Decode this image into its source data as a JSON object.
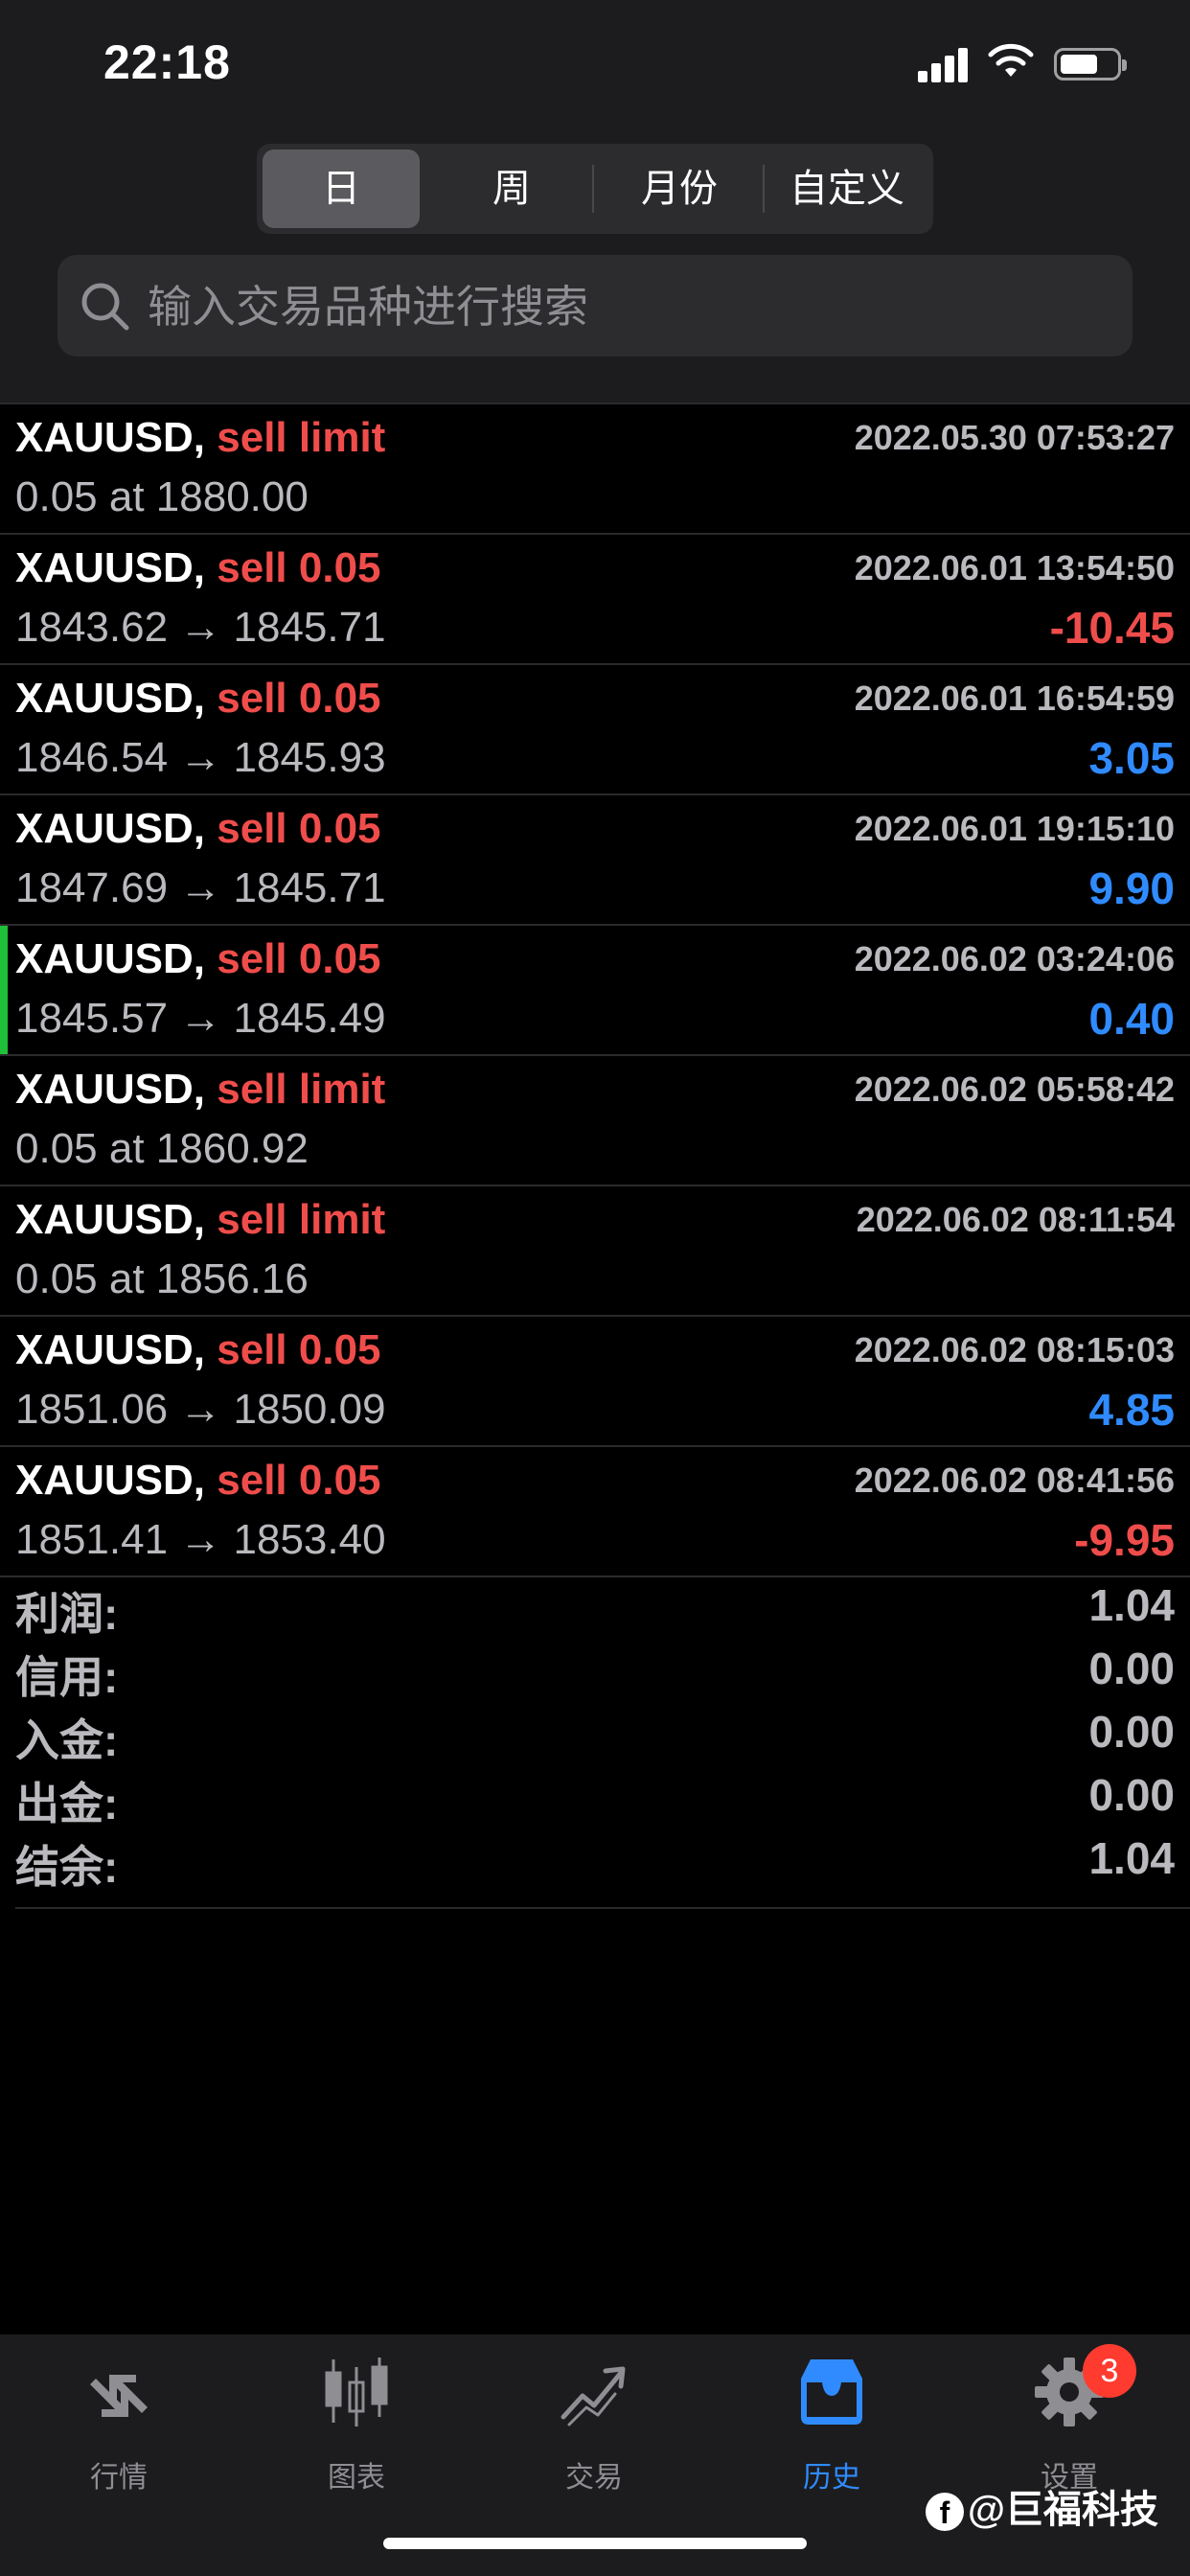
{
  "status_bar": {
    "time": "22:18"
  },
  "segments": [
    {
      "label": "日",
      "active": true
    },
    {
      "label": "周",
      "active": false
    },
    {
      "label": "月份",
      "active": false
    },
    {
      "label": "自定义",
      "active": false
    }
  ],
  "search": {
    "placeholder": "输入交易品种进行搜索",
    "value": ""
  },
  "history": [
    {
      "symbol": "XAUUSD,",
      "type": "sell limit",
      "time": "2022.05.30 07:53:27",
      "price": "0.05 at 1880.00",
      "profit": ""
    },
    {
      "symbol": "XAUUSD,",
      "type": "sell 0.05",
      "time": "2022.06.01 13:54:50",
      "price": "1843.62 → 1845.71",
      "profit": "-10.45"
    },
    {
      "symbol": "XAUUSD,",
      "type": "sell 0.05",
      "time": "2022.06.01 16:54:59",
      "price": "1846.54 → 1845.93",
      "profit": "3.05"
    },
    {
      "symbol": "XAUUSD,",
      "type": "sell 0.05",
      "time": "2022.06.01 19:15:10",
      "price": "1847.69 → 1845.71",
      "profit": "9.90"
    },
    {
      "symbol": "XAUUSD,",
      "type": "sell 0.05",
      "time": "2022.06.02 03:24:06",
      "price": "1845.57 → 1845.49",
      "profit": "0.40",
      "selected": true
    },
    {
      "symbol": "XAUUSD,",
      "type": "sell limit",
      "time": "2022.06.02 05:58:42",
      "price": "0.05 at 1860.92",
      "profit": ""
    },
    {
      "symbol": "XAUUSD,",
      "type": "sell limit",
      "time": "2022.06.02 08:11:54",
      "price": "0.05 at 1856.16",
      "profit": ""
    },
    {
      "symbol": "XAUUSD,",
      "type": "sell 0.05",
      "time": "2022.06.02 08:15:03",
      "price": "1851.06 → 1850.09",
      "profit": "4.85"
    },
    {
      "symbol": "XAUUSD,",
      "type": "sell 0.05",
      "time": "2022.06.02 08:41:56",
      "price": "1851.41 → 1853.40",
      "profit": "-9.95"
    }
  ],
  "summary": [
    {
      "label": "利润:",
      "value": "1.04"
    },
    {
      "label": "信用:",
      "value": "0.00"
    },
    {
      "label": "入金:",
      "value": "0.00"
    },
    {
      "label": "出金:",
      "value": "0.00"
    },
    {
      "label": "结余:",
      "value": "1.04"
    }
  ],
  "tabs": [
    {
      "label": "行情",
      "icon": "quotes-arrows-icon",
      "active": false
    },
    {
      "label": "图表",
      "icon": "candlestick-chart-icon",
      "active": false
    },
    {
      "label": "交易",
      "icon": "trade-trend-icon",
      "active": false
    },
    {
      "label": "历史",
      "icon": "history-inbox-icon",
      "active": true
    },
    {
      "label": "设置",
      "icon": "gear-icon",
      "active": false,
      "badge": "3"
    }
  ],
  "watermark": {
    "text": "@巨福科技",
    "logo": "f"
  },
  "colors": {
    "sell": "#ef4d4b",
    "loss": "#ef4d4b",
    "gain": "#2f8bff",
    "active_tab": "#2f8bff",
    "selected_marker": "#1fc13a"
  }
}
